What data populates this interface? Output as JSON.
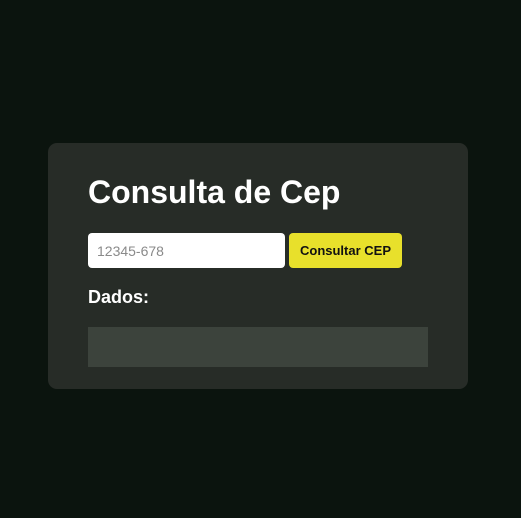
{
  "app": {
    "title": "Consulta de Cep"
  },
  "search": {
    "value": "",
    "placeholder": "12345-678",
    "button_label": "Consultar CEP"
  },
  "results": {
    "label": "Dados:",
    "content": ""
  },
  "colors": {
    "background": "#0b140e",
    "card": "#272c27",
    "accent": "#e8e02b",
    "result_box": "#3c433c"
  }
}
